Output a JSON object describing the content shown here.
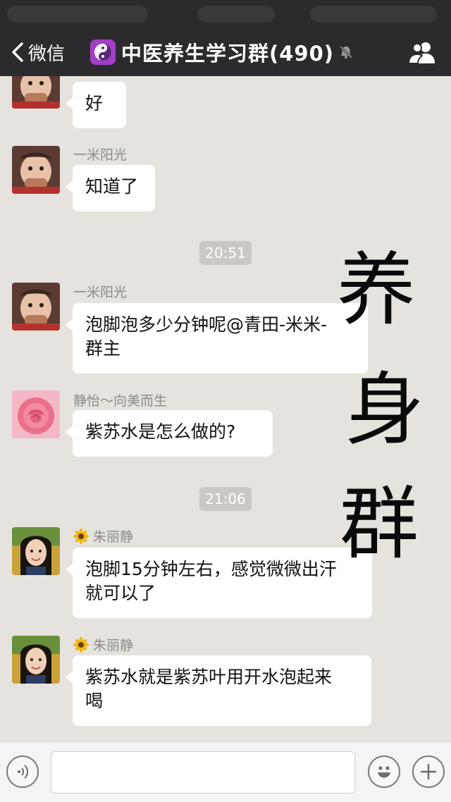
{
  "nav": {
    "back_label": "微信",
    "title": "中医养生学习群(490)"
  },
  "messages": [
    {
      "sender": "",
      "text": "好"
    },
    {
      "sender": "一米阳光",
      "text": "知道了"
    },
    {
      "sender": "一米阳光",
      "text_line1": "泡脚泡多少分钟呢@青田-米米-",
      "text_line2": "群主"
    },
    {
      "sender": "静怡～向美而生",
      "text": "紫苏水是怎么做的?"
    },
    {
      "sender": "朱丽静",
      "text_line1": "泡脚15分钟左右，感觉微微出汗",
      "text_line2": "就可以了"
    },
    {
      "sender": "朱丽静",
      "text_line1": "紫苏水就是紫苏叶用开水泡起来",
      "text_line2": "喝"
    }
  ],
  "timestamps": [
    "20:51",
    "21:06"
  ],
  "overlay": {
    "char1": "养",
    "char2": "身",
    "char3": "群"
  },
  "icons": {
    "back": "chevron-left-icon",
    "group": "taiji-icon",
    "mute": "mute-bell-icon",
    "members": "group-members-icon",
    "voice": "voice-icon",
    "emoji": "emoji-icon",
    "plus": "plus-icon",
    "sender_badge": "sunflower-icon"
  },
  "colors": {
    "navbar": "#2b2b2d",
    "chat_bg": "#e6e3de",
    "bubble": "#ffffff",
    "group_icon": "#a23ec7"
  }
}
